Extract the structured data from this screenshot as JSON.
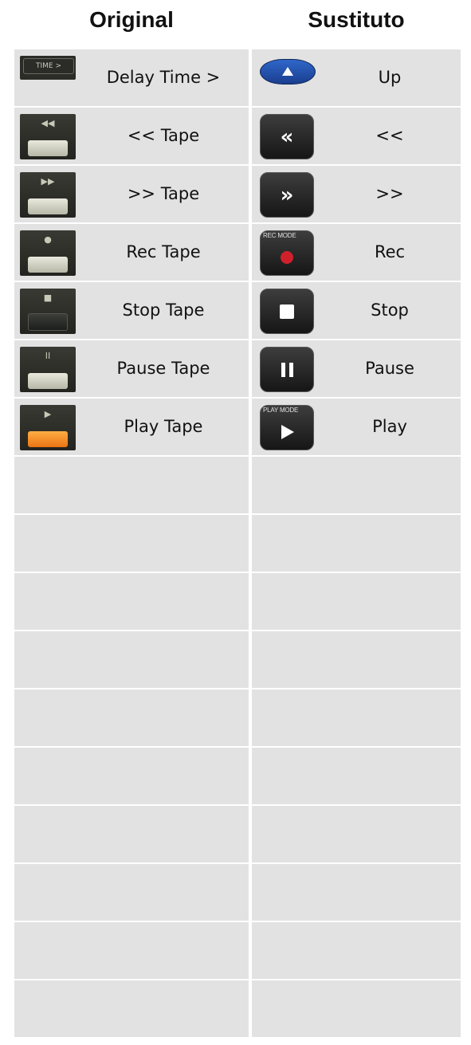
{
  "header": {
    "original_title": "Original",
    "substitute_title": "Sustituto"
  },
  "rows": [
    {
      "original": {
        "label": "Delay Time >",
        "icon": "delay-time-button-icon",
        "key_text": "TIME >"
      },
      "substitute": {
        "label": "Up",
        "icon": "up-arrow-button-icon"
      }
    },
    {
      "original": {
        "label": "<< Tape",
        "icon": "rewind-tape-button-icon",
        "symbol": "◀◀"
      },
      "substitute": {
        "label": "<<",
        "icon": "rewind-button-icon",
        "glyph": "«"
      }
    },
    {
      "original": {
        "label": ">> Tape",
        "icon": "fast-forward-tape-button-icon",
        "symbol": "▶▶"
      },
      "substitute": {
        "label": ">>",
        "icon": "fast-forward-button-icon",
        "glyph": "»"
      }
    },
    {
      "original": {
        "label": "Rec Tape",
        "icon": "record-tape-button-icon",
        "symbol": "●"
      },
      "substitute": {
        "label": "Rec",
        "icon": "record-button-icon",
        "tag": "REC MODE"
      }
    },
    {
      "original": {
        "label": "Stop Tape",
        "icon": "stop-tape-button-icon",
        "symbol": "■"
      },
      "substitute": {
        "label": "Stop",
        "icon": "stop-button-icon"
      }
    },
    {
      "original": {
        "label": "Pause Tape",
        "icon": "pause-tape-button-icon",
        "symbol": "II"
      },
      "substitute": {
        "label": "Pause",
        "icon": "pause-button-icon"
      }
    },
    {
      "original": {
        "label": "Play Tape",
        "icon": "play-tape-button-icon",
        "symbol": "▶"
      },
      "substitute": {
        "label": "Play",
        "icon": "play-button-icon",
        "tag": "PLAY MODE"
      }
    }
  ],
  "empty_rows": 10,
  "colors": {
    "cell_background": "#e2e2e2",
    "play_key": "#ea7413",
    "record_dot": "#d0212b",
    "up_button": "#2f67c9"
  }
}
